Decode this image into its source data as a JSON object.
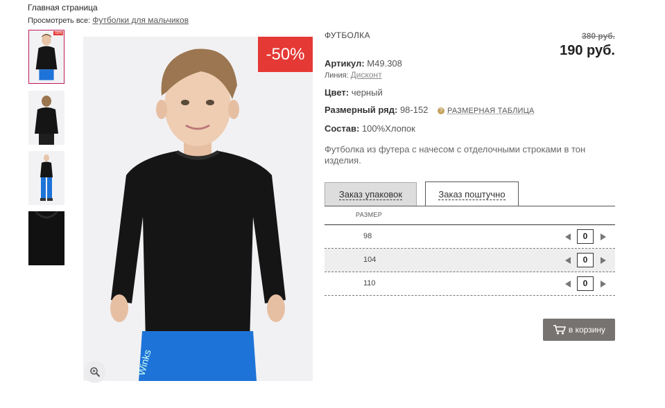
{
  "breadcrumb": {
    "home": "Главная страница",
    "view_all_label": "Просмотреть все:",
    "view_all_link": "Футболки для мальчиков"
  },
  "gallery": {
    "thumbnails": [
      "thumb-front",
      "thumb-back",
      "thumb-full",
      "thumb-detail"
    ],
    "selected_index": 0,
    "discount_badge": "-50%",
    "mini_badge": "-50%",
    "zoom_icon": "zoom-in-icon"
  },
  "product": {
    "type": "ФУТБОЛКА",
    "old_price": "380 руб.",
    "new_price": "190 руб.",
    "article_label": "Артикул:",
    "article_value": "М49.308",
    "line_label": "Линия:",
    "line_value": "Дисконт",
    "color_label": "Цвет:",
    "color_value": "черный",
    "size_range_label": "Размерный ряд:",
    "size_range_value": "98-152",
    "help_icon": "?",
    "size_table_link": "РАЗМЕРНАЯ ТАБЛИЦА",
    "composition_label": "Состав:",
    "composition_value": "100%Хлопок",
    "description": "Футболка из футера с начесом с отделочными строками в тон изделия."
  },
  "order": {
    "tabs": [
      {
        "label": "Заказ упаковок",
        "active": false
      },
      {
        "label": "Заказ поштучно",
        "active": true
      }
    ],
    "size_header": "РАЗМЕР",
    "rows": [
      {
        "size": "98",
        "qty": "0"
      },
      {
        "size": "104",
        "qty": "0"
      },
      {
        "size": "110",
        "qty": "0"
      }
    ],
    "cart_button": "в корзину",
    "cart_icon": "cart-icon"
  },
  "colors": {
    "accent_red": "#e53935",
    "selected_thumb_border": "#c2185b",
    "cart_button_bg": "#777370"
  }
}
